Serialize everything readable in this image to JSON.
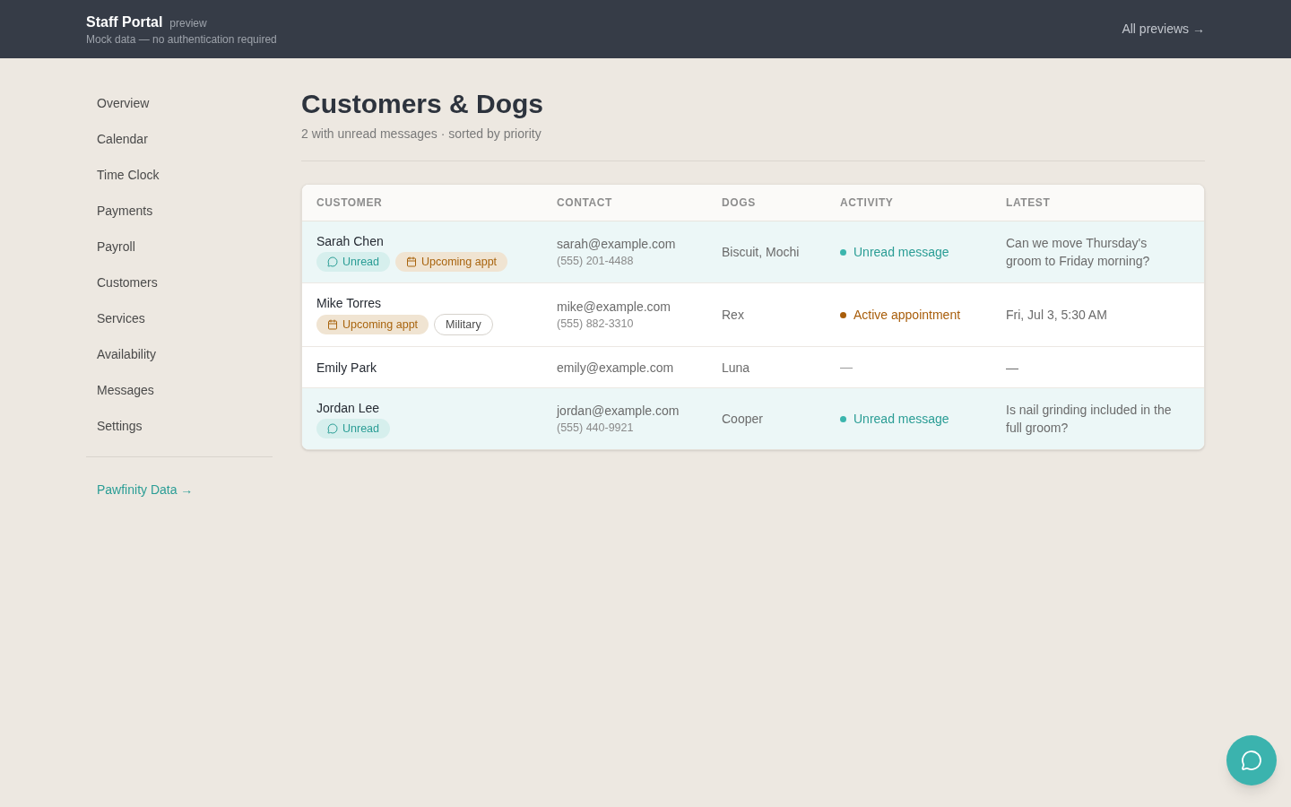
{
  "header": {
    "title": "Staff Portal",
    "tag": "preview",
    "subtitle": "Mock data — no authentication required",
    "link": "All previews →"
  },
  "sidebar": {
    "items": [
      {
        "label": "Overview"
      },
      {
        "label": "Calendar"
      },
      {
        "label": "Time Clock"
      },
      {
        "label": "Payments"
      },
      {
        "label": "Payroll"
      },
      {
        "label": "Customers"
      },
      {
        "label": "Services"
      },
      {
        "label": "Availability"
      },
      {
        "label": "Messages"
      },
      {
        "label": "Settings"
      }
    ],
    "footer_link": "Pawfinity Data →"
  },
  "page": {
    "title": "Customers & Dogs",
    "subtitle": "2 with unread messages · sorted by priority"
  },
  "table": {
    "columns": [
      "CUSTOMER",
      "CONTACT",
      "DOGS",
      "ACTIVITY",
      "LATEST"
    ],
    "rows": [
      {
        "highlighted": true,
        "name": "Sarah Chen",
        "badges": [
          {
            "kind": "unread",
            "label": "Unread"
          },
          {
            "kind": "appointment",
            "label": "Upcoming appt"
          }
        ],
        "email": "sarah@example.com",
        "phone": "(555) 201-4488",
        "dogs": "Biscuit, Mochi",
        "activity": {
          "kind": "unread",
          "label": "Unread message"
        },
        "latest": "Can we move Thursday's groom to Friday morning?"
      },
      {
        "highlighted": false,
        "name": "Mike Torres",
        "badges": [
          {
            "kind": "appointment",
            "label": "Upcoming appt"
          },
          {
            "kind": "tag",
            "label": "Military"
          }
        ],
        "email": "mike@example.com",
        "phone": "(555) 882-3310",
        "dogs": "Rex",
        "activity": {
          "kind": "appointment",
          "label": "Active appointment"
        },
        "latest": "Fri, Jul 3, 5:30 AM"
      },
      {
        "highlighted": false,
        "name": "Emily Park",
        "email": "emily@example.com",
        "dogs": "Luna",
        "activity": {
          "kind": "none",
          "label": "—"
        },
        "latest": "—"
      },
      {
        "highlighted": true,
        "name": "Jordan Lee",
        "badges": [
          {
            "kind": "unread",
            "label": "Unread"
          }
        ],
        "email": "jordan@example.com",
        "phone": "(555) 440-9921",
        "dogs": "Cooper",
        "activity": {
          "kind": "unread",
          "label": "Unread message"
        },
        "latest": "Is nail grinding included in the full groom?"
      }
    ]
  }
}
